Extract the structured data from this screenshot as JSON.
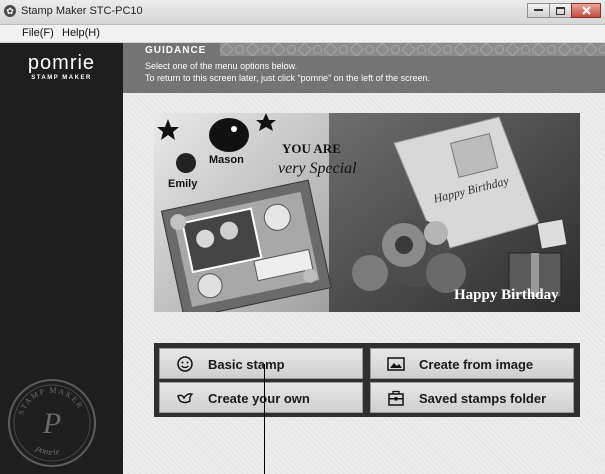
{
  "window": {
    "title": "Stamp Maker STC-PC10"
  },
  "menu": {
    "items": [
      "File(F)",
      "Help(H)"
    ]
  },
  "brand": {
    "name": "pomrie",
    "subtitle": "STAMP MAKER"
  },
  "seal": {
    "top_text": "STAMP MAKER",
    "bottom_text": "pomrie",
    "letter": "P"
  },
  "guidance": {
    "title": "GUIDANCE",
    "line1": "Select one of the menu options below.",
    "line2": "To return to this screen later, just click “pomrie” on the left of the screen."
  },
  "photo": {
    "stamp_text_1": "YOU ARE",
    "stamp_text_2": "very Special",
    "name_1": "Mason",
    "name_2": "Emily",
    "card_text": "Happy Birthday",
    "banner_text": "Happy Birthday"
  },
  "menu_buttons": {
    "basic": {
      "label": "Basic stamp",
      "icon": "smiley-icon"
    },
    "from_image": {
      "label": "Create from image",
      "icon": "image-icon"
    },
    "own": {
      "label": "Create your own",
      "icon": "bird-icon"
    },
    "saved": {
      "label": "Saved stamps folder",
      "icon": "folder-cabinet-icon"
    }
  }
}
